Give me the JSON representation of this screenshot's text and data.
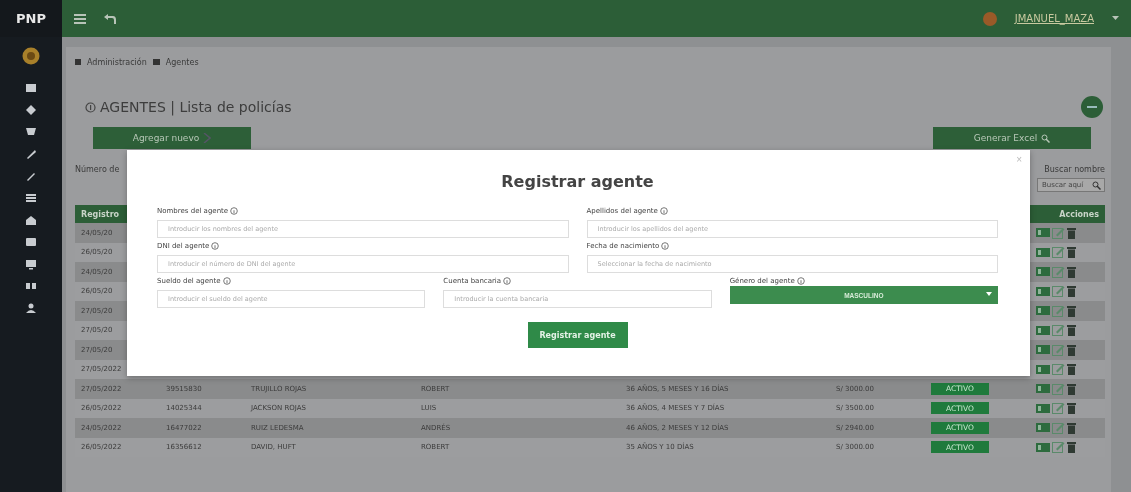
{
  "brand": "PNP",
  "user": {
    "name": "JMANUEL_MAZA"
  },
  "breadcrumb": [
    "Administración",
    "Agentes"
  ],
  "page_title": "AGENTES | Lista de policías",
  "add_button": "Agregar nuevo",
  "excel_button": "Generar Excel",
  "records_label": "Número de",
  "search_label": "Buscar nombre",
  "search": {
    "placeholder": "Buscar aquí"
  },
  "table": {
    "columns": [
      "Registro",
      "Acciones"
    ],
    "rows": [
      {
        "kind": "covered",
        "registro": "24/05/20"
      },
      {
        "kind": "covered",
        "registro": "26/05/20"
      },
      {
        "kind": "covered",
        "registro": "24/05/20"
      },
      {
        "kind": "covered",
        "registro": "26/05/20"
      },
      {
        "kind": "covered",
        "registro": "27/05/20"
      },
      {
        "kind": "covered",
        "registro": "27/05/20"
      },
      {
        "kind": "covered",
        "registro": "27/05/20"
      },
      {
        "kind": "partial",
        "registro": "27/05/2022"
      },
      {
        "kind": "full",
        "registro": "27/05/2022",
        "dni": "39515830",
        "apellidos": "TRUJILLO ROJAS",
        "nombres": "ROBERT",
        "edad": "36 AÑOS, 5 MESES Y 16 DÍAS",
        "sueldo": "S/ 3000.00",
        "estado": "ACTIVO"
      },
      {
        "kind": "full",
        "registro": "26/05/2022",
        "dni": "14025344",
        "apellidos": "JACKSON ROJAS",
        "nombres": "LUIS",
        "edad": "36 AÑOS, 4 MESES Y 7 DÍAS",
        "sueldo": "S/ 3500.00",
        "estado": "ACTIVO"
      },
      {
        "kind": "full",
        "registro": "24/05/2022",
        "dni": "16477022",
        "apellidos": "RUIZ LEDESMA",
        "nombres": "ANDRÉS",
        "edad": "46 AÑOS, 2 MESES Y 12 DÍAS",
        "sueldo": "S/ 2940.00",
        "estado": "ACTIVO"
      },
      {
        "kind": "full",
        "registro": "26/05/2022",
        "dni": "16356612",
        "apellidos": "DAVID, HUFT",
        "nombres": "ROBERT",
        "edad": "35 AÑOS Y 10 DÍAS",
        "sueldo": "S/ 3000.00",
        "estado": "ACTIVO"
      }
    ]
  },
  "modal": {
    "title": "Registrar agente",
    "close": "×",
    "fields": [
      {
        "kind": "input",
        "label": "Nombres del agente",
        "placeholder": "Introducir los nombres del agente"
      },
      {
        "kind": "input",
        "label": "Apellidos del agente",
        "placeholder": "Introducir los apellidos del agente"
      },
      {
        "kind": "input",
        "label": "DNI del agente",
        "placeholder": "Introducir el número de DNI del agente"
      },
      {
        "kind": "input",
        "label": "Fecha de nacimiento",
        "placeholder": "Seleccionar la fecha de nacimiento"
      },
      {
        "kind": "input",
        "label": "Sueldo del agente",
        "placeholder": "Introducir el sueldo del agente"
      },
      {
        "kind": "input",
        "label": "Cuenta bancaria",
        "placeholder": "Introducir la cuenta bancaria"
      },
      {
        "kind": "select",
        "label": "Género del agente",
        "value": "MASCULINO"
      }
    ],
    "submit": "Registrar agente"
  }
}
